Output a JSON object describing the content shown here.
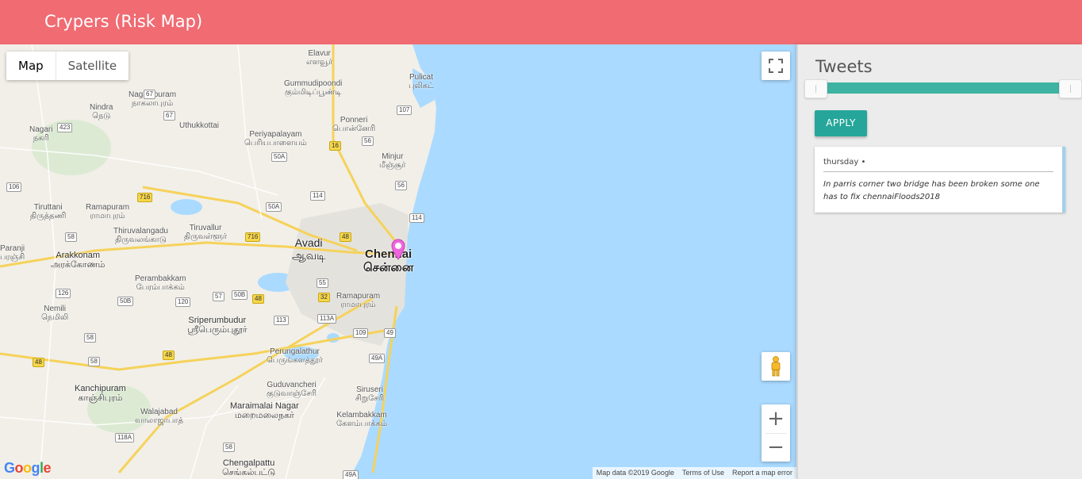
{
  "app": {
    "title": "Crypers (Risk Map)"
  },
  "map": {
    "type_control": {
      "map": "Map",
      "satellite": "Satellite"
    },
    "zoom": {
      "in": "+",
      "out": "−"
    },
    "google_logo": "Google",
    "attribution": {
      "data": "Map data ©2019 Google",
      "terms": "Terms of Use",
      "report": "Report a map error"
    },
    "places": [
      {
        "en": "Elavur",
        "ta": "எளவூர்"
      },
      {
        "en": "Pulicat",
        "ta": "புலிகட்"
      },
      {
        "en": "Gummudipoondi",
        "ta": "கும்மிடிப்பூண்டி"
      },
      {
        "en": "Nagalapuram",
        "ta": "நாகலாபுரம்"
      },
      {
        "en": "Nindra",
        "ta": "நெடு"
      },
      {
        "en": "Uthukkottai",
        "ta": ""
      },
      {
        "en": "Ponneri",
        "ta": "பொன்னேரி"
      },
      {
        "en": "Nagari",
        "ta": "நகரி"
      },
      {
        "en": "Periyapalayam",
        "ta": "பெரியபாளையம்"
      },
      {
        "en": "Minjur",
        "ta": "மீஞ்சூர்"
      },
      {
        "en": "Tiruttani",
        "ta": "திருத்தணி"
      },
      {
        "en": "Ramapuram",
        "ta": "ராமாபுரம்"
      },
      {
        "en": "Thiruvalangadu",
        "ta": "திருவலங்காடு"
      },
      {
        "en": "Tiruvallur",
        "ta": "திருவள்ளூர்"
      },
      {
        "en": "Avadi",
        "ta": "ஆவடி"
      },
      {
        "en": "Chennai",
        "ta": "சென்னை"
      },
      {
        "en": "Paranji",
        "ta": "பரஞ்சி"
      },
      {
        "en": "Arakkonam",
        "ta": "அரக்கோணம்"
      },
      {
        "en": "Perambakkam",
        "ta": "பேரம்பாக்கம்"
      },
      {
        "en": "Nemili",
        "ta": "நெமிலி"
      },
      {
        "en": "Ramapuram",
        "ta": "ராமாபுரம்"
      },
      {
        "en": "Sriperumbudur",
        "ta": "ஸ்ரீபெரும்புதூர்"
      },
      {
        "en": "Perungalathur",
        "ta": "பெருங்களத்தூர்"
      },
      {
        "en": "Guduvancheri",
        "ta": "குடுவாஞ்சேரி"
      },
      {
        "en": "Siruseri",
        "ta": "சிறுசேரி"
      },
      {
        "en": "Kanchipuram",
        "ta": "காஞ்சிபுரம்"
      },
      {
        "en": "Walajabad",
        "ta": "வாலாஜாபாத்"
      },
      {
        "en": "Maraimalai Nagar",
        "ta": "மறைமலைநகர்"
      },
      {
        "en": "Kelambakkam",
        "ta": "கேளம்பாக்கம்"
      },
      {
        "en": "Chengalpattu",
        "ta": "செங்கல்பட்டு"
      }
    ],
    "shields": [
      "423",
      "67",
      "67",
      "107",
      "16",
      "56",
      "50A",
      "56",
      "716",
      "114",
      "106",
      "50A",
      "114",
      "58",
      "716",
      "48",
      "55",
      "126",
      "50B",
      "120",
      "57",
      "50B",
      "48",
      "32",
      "113",
      "113A",
      "109",
      "49",
      "58",
      "48",
      "58",
      "48",
      "49A",
      "118A",
      "58",
      "49A"
    ]
  },
  "panel": {
    "title": "Tweets",
    "slider": {
      "low": 0,
      "high": 1
    },
    "apply_label": "APPLY",
    "tweets": [
      {
        "day": "thursday •",
        "text": "In parris corner two bridge has been broken some one has to fix chennaiFloods2018"
      }
    ]
  },
  "colors": {
    "header": "#f06b72",
    "accent": "#26a69a",
    "slider": "#3fb3a2",
    "sea": "#aadaff",
    "marker": "#ee66dd"
  }
}
